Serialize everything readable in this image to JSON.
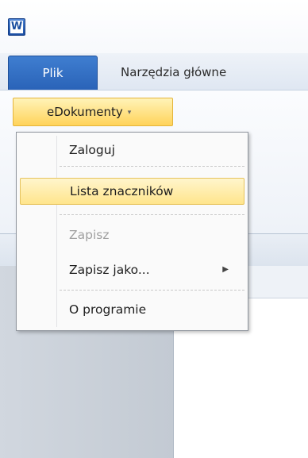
{
  "app": {
    "icon_letter": "W"
  },
  "tabs": {
    "file_label": "Plik",
    "home_label": "Narzędzia główne"
  },
  "ribbon": {
    "edokumenty_label": "eDokumenty",
    "edokumenty_caret": "▾"
  },
  "menu": {
    "items": [
      {
        "label": "Zaloguj",
        "enabled": true
      },
      {
        "label": "Lista znaczników",
        "enabled": true,
        "highlighted": true
      },
      {
        "label": "Zapisz",
        "enabled": false
      },
      {
        "label": "Zapisz jako...",
        "enabled": true,
        "submenu": true
      },
      {
        "label": "O programie",
        "enabled": true
      }
    ],
    "submenu_arrow": "▶"
  }
}
